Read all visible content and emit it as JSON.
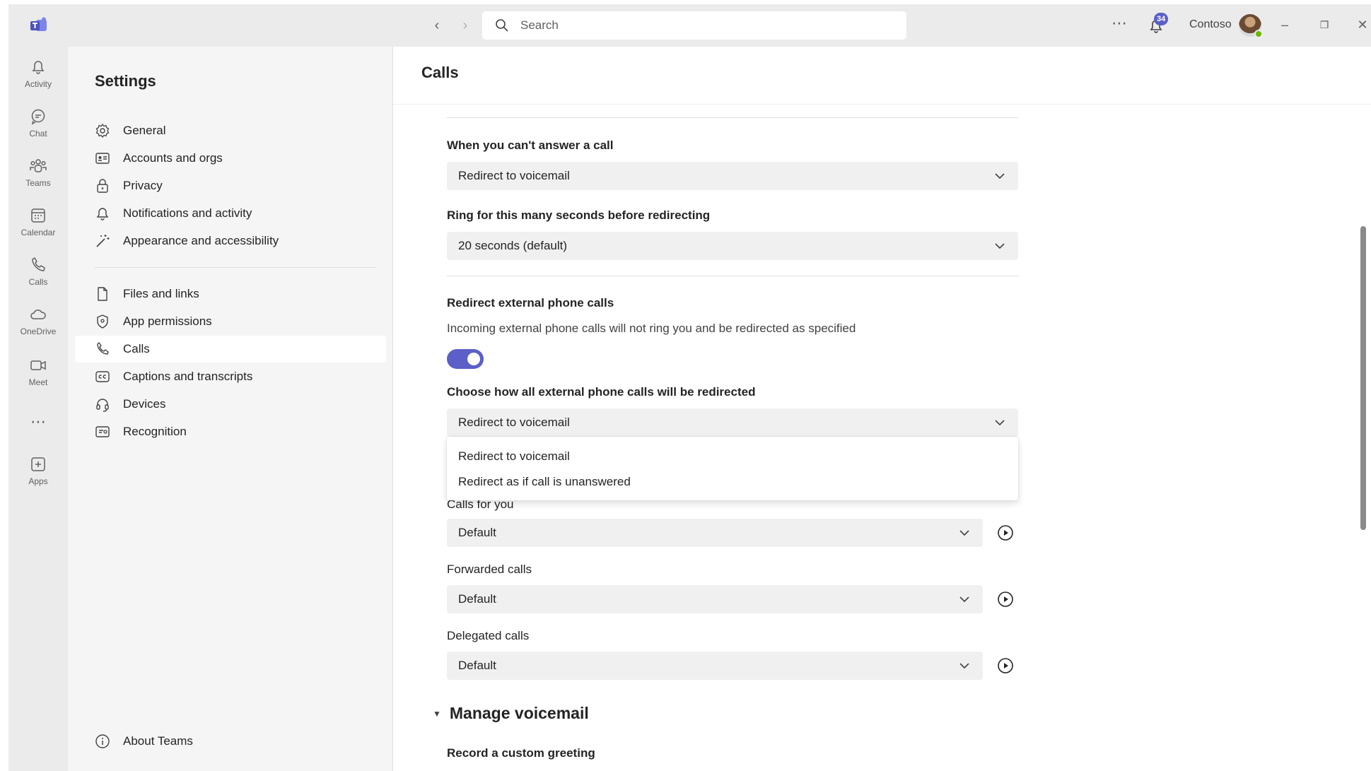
{
  "titlebar": {
    "search_placeholder": "Search",
    "notifications_badge": "34",
    "org_name": "Contoso"
  },
  "rail": {
    "items": [
      {
        "label": "Activity",
        "icon": "bell-icon"
      },
      {
        "label": "Chat",
        "icon": "chat-icon"
      },
      {
        "label": "Teams",
        "icon": "teams-icon"
      },
      {
        "label": "Calendar",
        "icon": "calendar-icon"
      },
      {
        "label": "Calls",
        "icon": "phone-icon"
      },
      {
        "label": "OneDrive",
        "icon": "cloud-icon"
      },
      {
        "label": "Meet",
        "icon": "video-icon"
      },
      {
        "label": "Apps",
        "icon": "add-apps-icon"
      }
    ]
  },
  "settings": {
    "title": "Settings",
    "items": [
      {
        "label": "General",
        "icon": "gear-icon"
      },
      {
        "label": "Accounts and orgs",
        "icon": "id-card-icon"
      },
      {
        "label": "Privacy",
        "icon": "lock-icon"
      },
      {
        "label": "Notifications and activity",
        "icon": "bell-icon"
      },
      {
        "label": "Appearance and accessibility",
        "icon": "wand-icon"
      },
      {
        "label": "Files and links",
        "icon": "document-icon"
      },
      {
        "label": "App permissions",
        "icon": "shield-icon"
      },
      {
        "label": "Calls",
        "icon": "phone-icon"
      },
      {
        "label": "Captions and transcripts",
        "icon": "cc-icon"
      },
      {
        "label": "Devices",
        "icon": "headset-icon"
      },
      {
        "label": "Recognition",
        "icon": "recognition-icon"
      }
    ],
    "selected": "Calls",
    "about": "About Teams"
  },
  "main": {
    "title": "Calls",
    "unanswered": {
      "label": "When you can't answer a call",
      "value": "Redirect to voicemail"
    },
    "ring": {
      "label": "Ring for this many seconds before redirecting",
      "value": "20 seconds (default)"
    },
    "external": {
      "label": "Redirect external phone calls",
      "description": "Incoming external phone calls will not ring you and be redirected as specified",
      "toggle_on": true,
      "choose_label": "Choose how all external phone calls will be redirected",
      "value": "Redirect to voicemail",
      "options": [
        "Redirect to voicemail",
        "Redirect as if call is unanswered"
      ]
    },
    "ringtones": [
      {
        "label": "Calls for you",
        "value": "Default"
      },
      {
        "label": "Forwarded calls",
        "value": "Default"
      },
      {
        "label": "Delegated calls",
        "value": "Default"
      }
    ],
    "voicemail": {
      "title": "Manage voicemail",
      "record_label": "Record a custom greeting"
    }
  },
  "colors": {
    "accent": "#5b5fc7",
    "presence": "#6bb700"
  }
}
